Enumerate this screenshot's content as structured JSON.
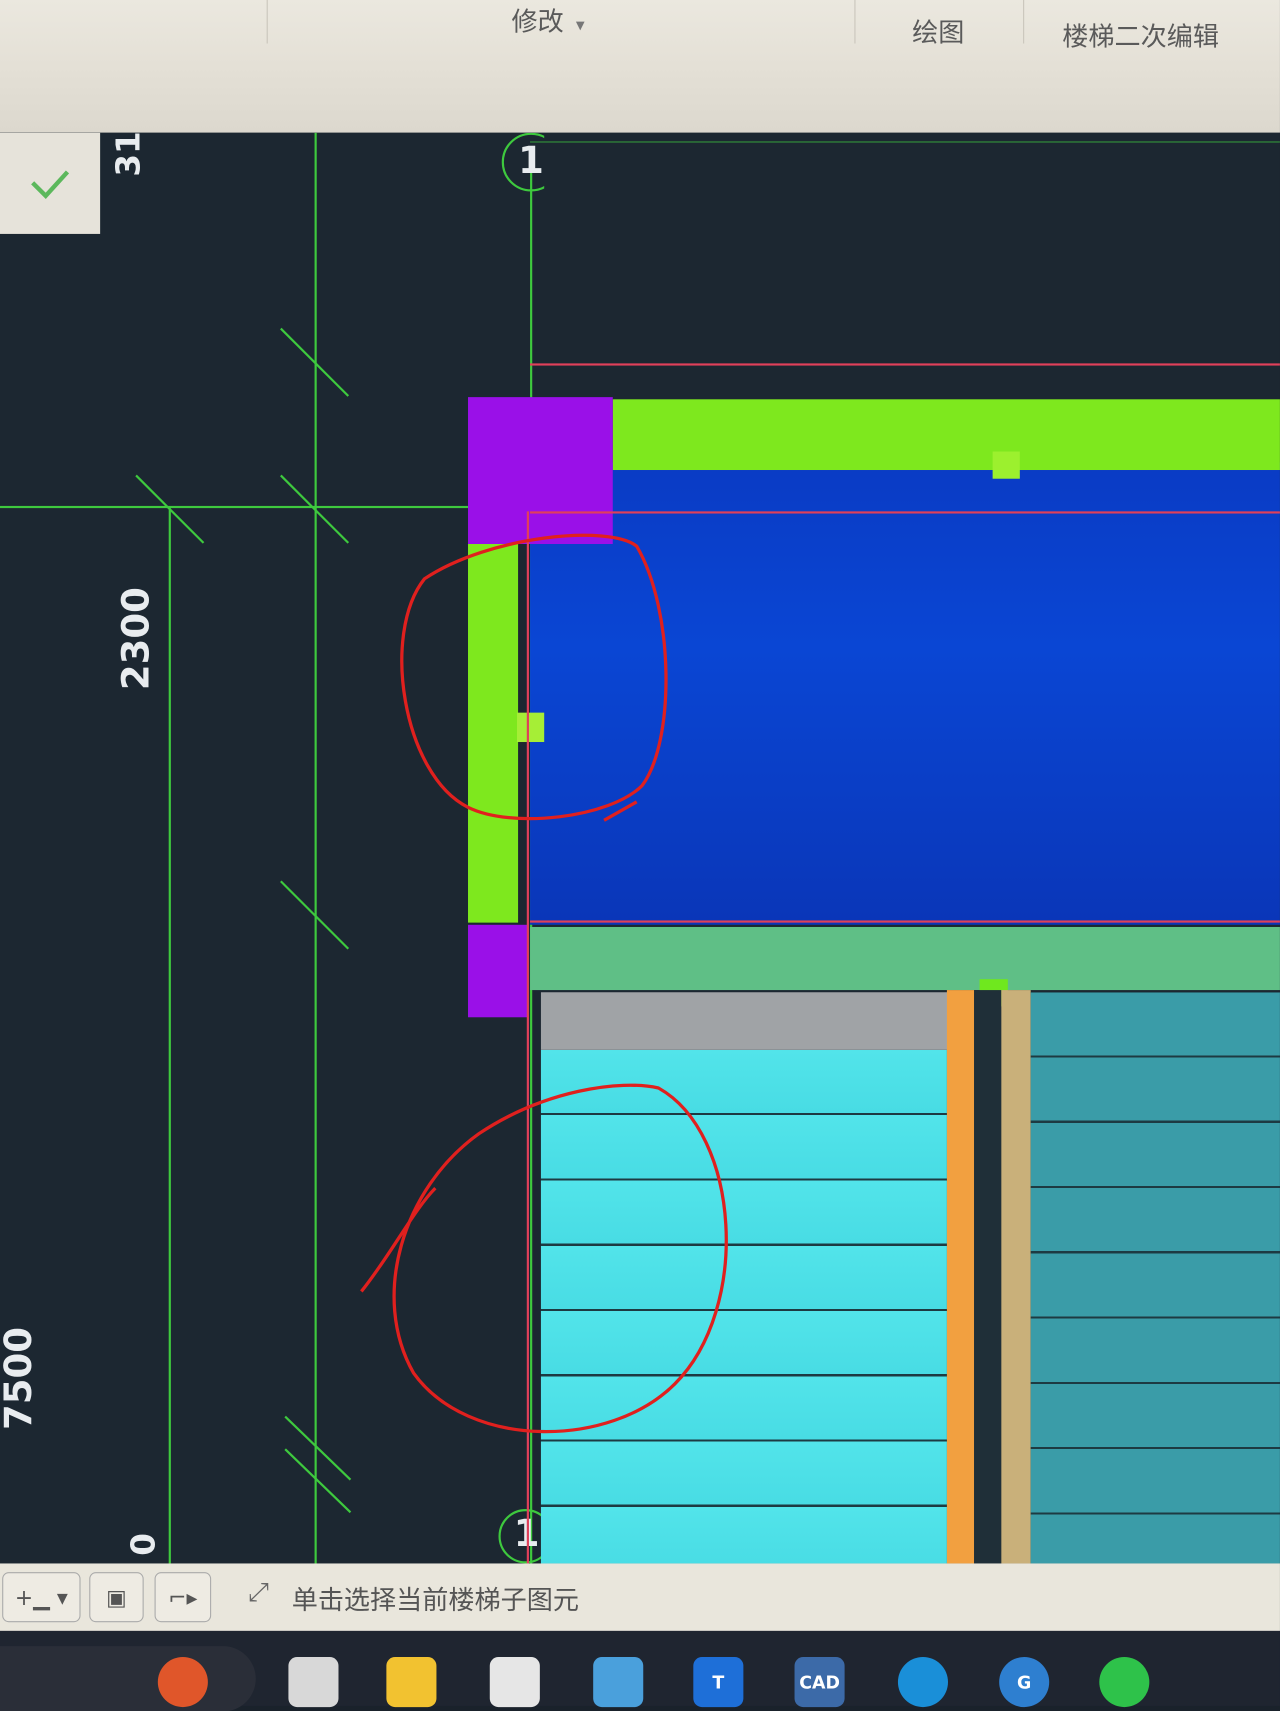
{
  "ribbon": {
    "tabs": [
      {
        "label": "修改",
        "dropdown": "▾"
      },
      {
        "label": "绘图"
      },
      {
        "label": "楼梯二次编辑"
      }
    ]
  },
  "canvas": {
    "confirm_icon": "check-icon",
    "dimensions": {
      "top": "31",
      "middle": "2300",
      "lower": "7500",
      "bottom": "0"
    },
    "axis_labels": {
      "top": "1",
      "bottom": "1"
    },
    "colors": {
      "background": "#1c2731",
      "grid": "#3ec93e",
      "slab": "#0a3fc8",
      "beam": "#7ee81e",
      "column": "#9a10e8",
      "stairs": "#52e4ea",
      "annotation": "#e0201e"
    }
  },
  "status_bar": {
    "buttons": [
      "add-dropdown",
      "display-toggle",
      "polyline-tool"
    ],
    "hint": "单击选择当前楼梯子图元"
  },
  "taskbar": {
    "apps": [
      "weather-widget",
      "file-app",
      "file-explorer",
      "cloud-app",
      "document-app",
      "structure-app",
      "CAD",
      "edge-browser",
      "sogou-input",
      "wechat"
    ],
    "cad_label": "CAD"
  }
}
